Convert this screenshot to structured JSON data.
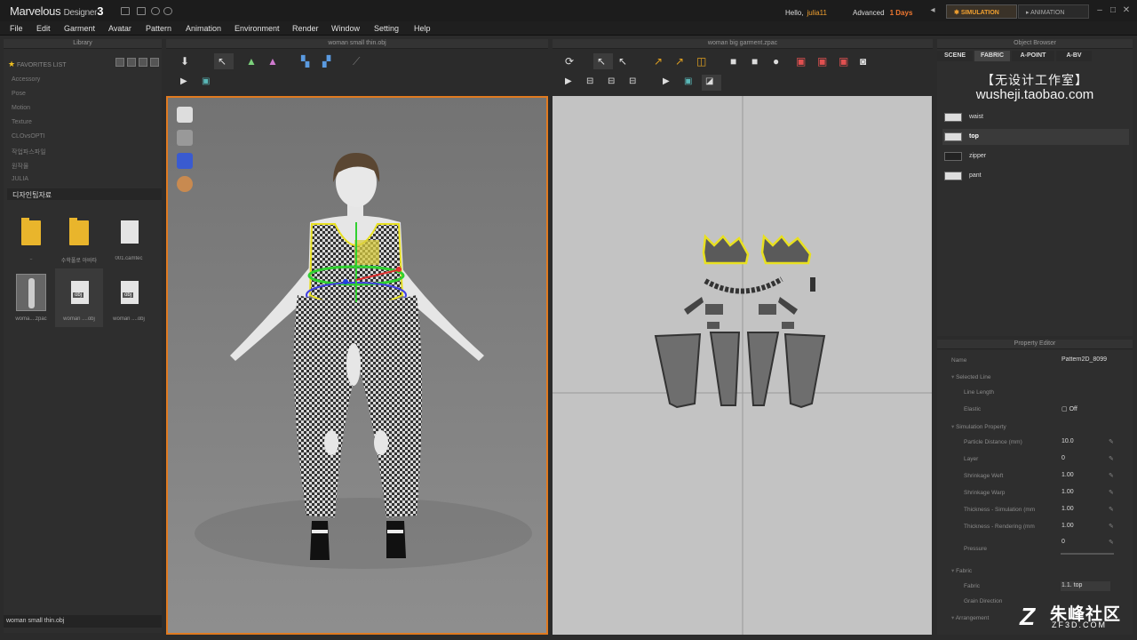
{
  "app": {
    "name": "Marvelous",
    "subtitle": "Designer",
    "version": "3"
  },
  "account": {
    "hello_label": "Hello,",
    "username": "julia11",
    "plan_label": "Advanced",
    "days_label": "1 Days"
  },
  "modes": {
    "simulation": "SIMULATION",
    "animation": "ANIMATION"
  },
  "menu": [
    "File",
    "Edit",
    "Garment",
    "Avatar",
    "Pattern",
    "Animation",
    "Environment",
    "Render",
    "Window",
    "Setting",
    "Help"
  ],
  "library": {
    "title": "Library",
    "favorites": "FAVORITES LIST",
    "items": [
      "Accessory",
      "Pose",
      "Motion",
      "Texture",
      "CLOvsOPTI",
      "작업파스파일",
      "원작물",
      "JULIA"
    ],
    "selected_folder": "디자인팁자료",
    "thumbnails": [
      {
        "type": "folder",
        "label": ".."
      },
      {
        "type": "folder",
        "label": "수학풀로 아바타"
      },
      {
        "type": "doc",
        "label": "001.camtec"
      },
      {
        "type": "avatar",
        "label": "woma....zpac"
      },
      {
        "type": "obj",
        "label": "woman ....obj"
      },
      {
        "type": "obj",
        "label": "woman ....obj"
      }
    ],
    "status": "woman small thin.obj"
  },
  "viewport3d": {
    "title": "woman small thin.obj"
  },
  "viewport2d": {
    "title": "woman big garment.zpac"
  },
  "object_browser": {
    "title": "Object Browser",
    "tabs": [
      "SCENE",
      "FABRIC",
      "A-POINT",
      "A-BV"
    ],
    "active_tab": "FABRIC",
    "fabrics": [
      {
        "name": "waist",
        "selected": false
      },
      {
        "name": "top",
        "selected": true
      },
      {
        "name": "zipper",
        "selected": false
      },
      {
        "name": "pant",
        "selected": false
      }
    ]
  },
  "watermark": {
    "cn": "【无设计工作室】",
    "url": "wusheji.taobao.com"
  },
  "property_editor": {
    "title": "Property Editor",
    "name_label": "Name",
    "name_value": "Pattern2D_8099",
    "selected_line": "Selected Line",
    "line_length": "Line Length",
    "elastic_label": "Elastic",
    "elastic_value": "Off",
    "sim_property": "Simulation Property",
    "props": [
      {
        "label": "Particle Distance (mm)",
        "value": "10.0"
      },
      {
        "label": "Layer",
        "value": "0"
      },
      {
        "label": "Shrinkage Weft",
        "value": "1.00"
      },
      {
        "label": "Shrinkage Warp",
        "value": "1.00"
      },
      {
        "label": "Thickness - Simulation (mm",
        "value": "1.00"
      },
      {
        "label": "Thickness - Rendering (mm",
        "value": "1.00"
      }
    ],
    "pressure_label": "Pressure",
    "pressure_value": "0",
    "fabric_section": "Fabric",
    "fabric_label": "Fabric",
    "fabric_value": "1.1. top",
    "grain_label": "Grain Direction",
    "arrangement": "Arrangement"
  },
  "corner_logo": {
    "big": "朱峰社区",
    "small": "ZF3D.COM"
  }
}
